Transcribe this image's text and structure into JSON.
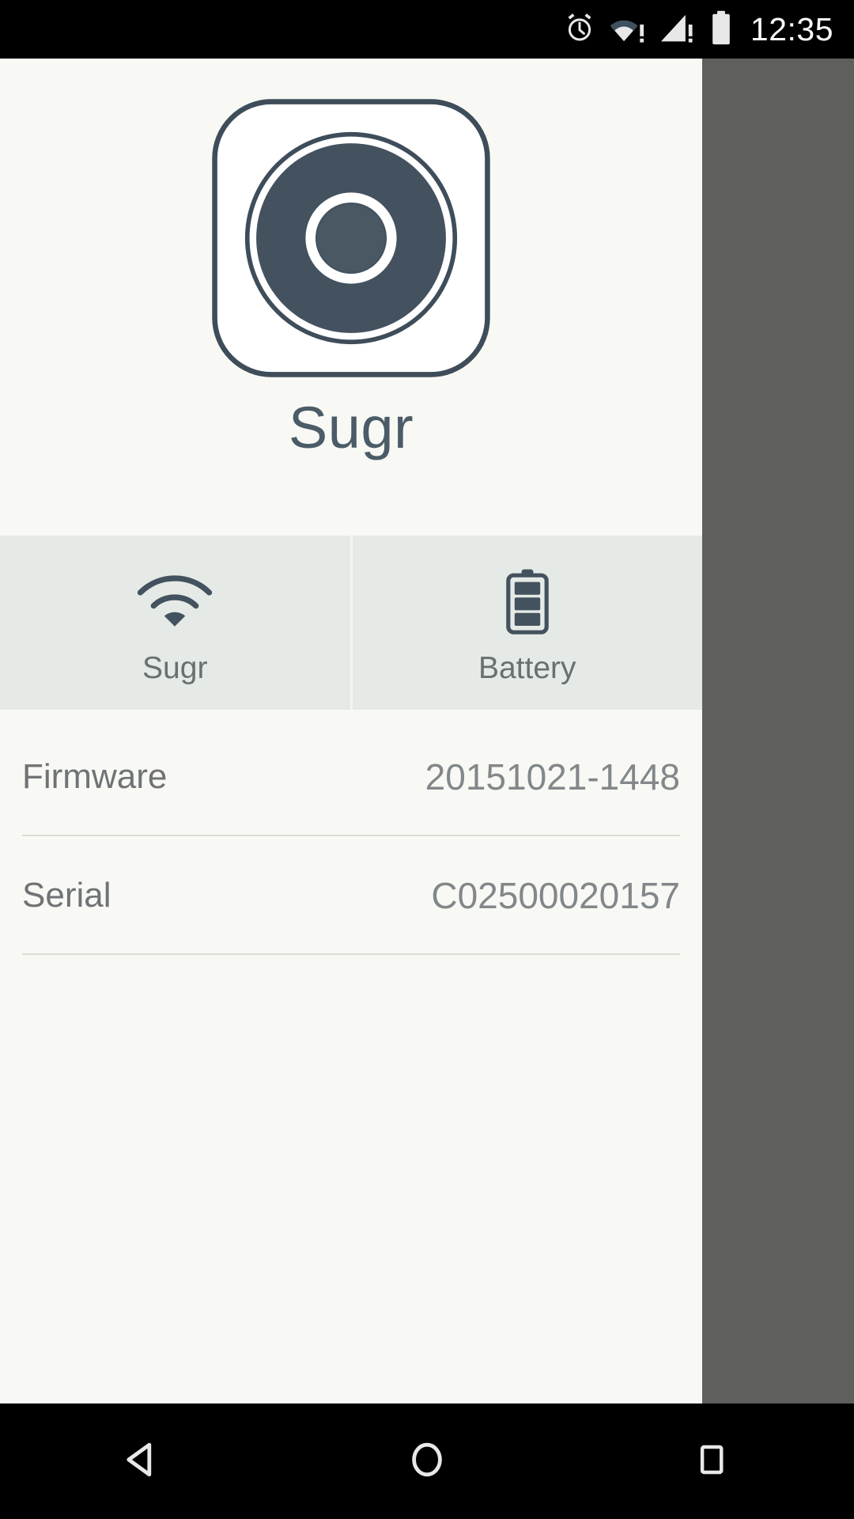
{
  "status_bar": {
    "clock": "12:35",
    "icons": [
      {
        "name": "alarm-icon",
        "label": "alarm"
      },
      {
        "name": "wifi-warning-icon",
        "label": "wifi no internet"
      },
      {
        "name": "cellular-warning-icon",
        "label": "cellular no service"
      },
      {
        "name": "battery-full-icon",
        "label": "battery full"
      }
    ],
    "background_color": "#000000",
    "foreground_color": "#fafafa"
  },
  "device": {
    "icon_name": "sugr-device-icon",
    "name": "Sugr",
    "accent_color": "#44525f",
    "panel_background": "#f8f9f4"
  },
  "tabs": [
    {
      "id": "sugr",
      "label": "Sugr",
      "icon": "wifi-icon"
    },
    {
      "id": "battery",
      "label": "Battery",
      "icon": "battery-icon"
    }
  ],
  "tab_strip": {
    "background_color": "#e5eae7",
    "label_color": "#6a6f71"
  },
  "info_list": {
    "rows": [
      {
        "label": "Firmware",
        "value": "20151021-1448"
      },
      {
        "label": "Serial",
        "value": "C02500020157"
      }
    ],
    "label_color": "#6f7375",
    "value_color": "#82878a",
    "divider_color": "#dcdcd6"
  },
  "nav_bar": {
    "background_color": "#000000",
    "buttons": [
      {
        "id": "back",
        "icon": "back-triangle-icon",
        "label": "Back"
      },
      {
        "id": "home",
        "icon": "home-circle-icon",
        "label": "Home"
      },
      {
        "id": "recents",
        "icon": "recents-square-icon",
        "label": "Recents"
      }
    ]
  },
  "chrome": {
    "filler_color": "#5f5f5d"
  }
}
